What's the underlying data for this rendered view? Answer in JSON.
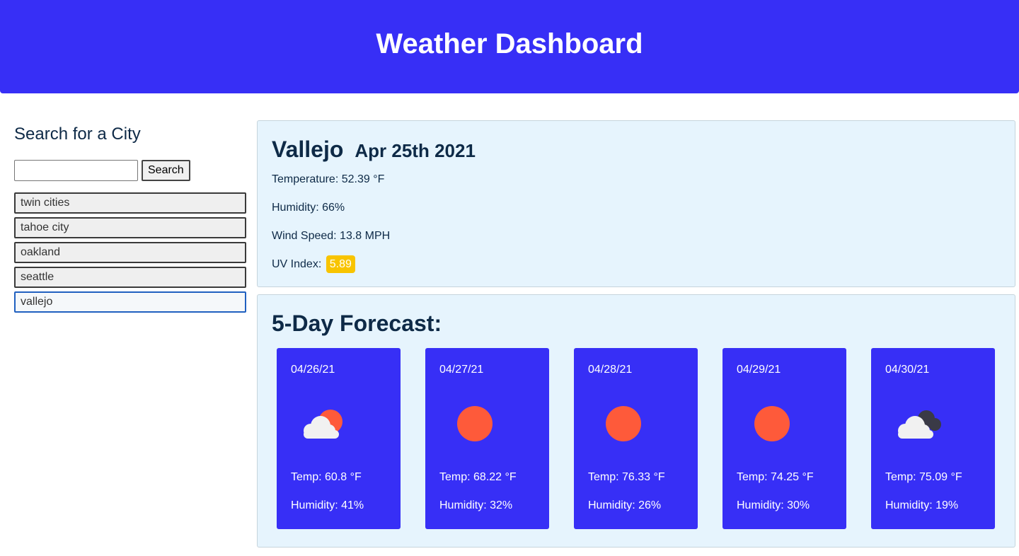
{
  "header": {
    "title": "Weather Dashboard"
  },
  "search": {
    "heading": "Search for a City",
    "input_value": "",
    "placeholder": "",
    "button_label": "Search"
  },
  "history": [
    "twin cities",
    "tahoe city",
    "oakland",
    "seattle",
    "vallejo"
  ],
  "current": {
    "city": "Vallejo",
    "date": "Apr 25th 2021",
    "temperature": "Temperature: 52.39 °F",
    "humidity": "Humidity: 66%",
    "wind": "Wind Speed: 13.8 MPH",
    "uv_label": "UV Index:",
    "uv_value": "5.89"
  },
  "forecast": {
    "heading": "5-Day Forecast:",
    "days": [
      {
        "date": "04/26/21",
        "icon": "partly-cloudy-icon",
        "temp": "Temp: 60.8 °F",
        "humidity": "Humidity: 41%"
      },
      {
        "date": "04/27/21",
        "icon": "sun-icon",
        "temp": "Temp: 68.22 °F",
        "humidity": "Humidity: 32%"
      },
      {
        "date": "04/28/21",
        "icon": "sun-icon",
        "temp": "Temp: 76.33 °F",
        "humidity": "Humidity: 26%"
      },
      {
        "date": "04/29/21",
        "icon": "sun-icon",
        "temp": "Temp: 74.25 °F",
        "humidity": "Humidity: 30%"
      },
      {
        "date": "04/30/21",
        "icon": "cloudy-icon",
        "temp": "Temp: 75.09 °F",
        "humidity": "Humidity: 19%"
      }
    ]
  },
  "colors": {
    "accent": "#372ff6",
    "panel": "#e6f4fd",
    "uv_badge": "#f8c400",
    "sun": "#fe5a3a"
  }
}
